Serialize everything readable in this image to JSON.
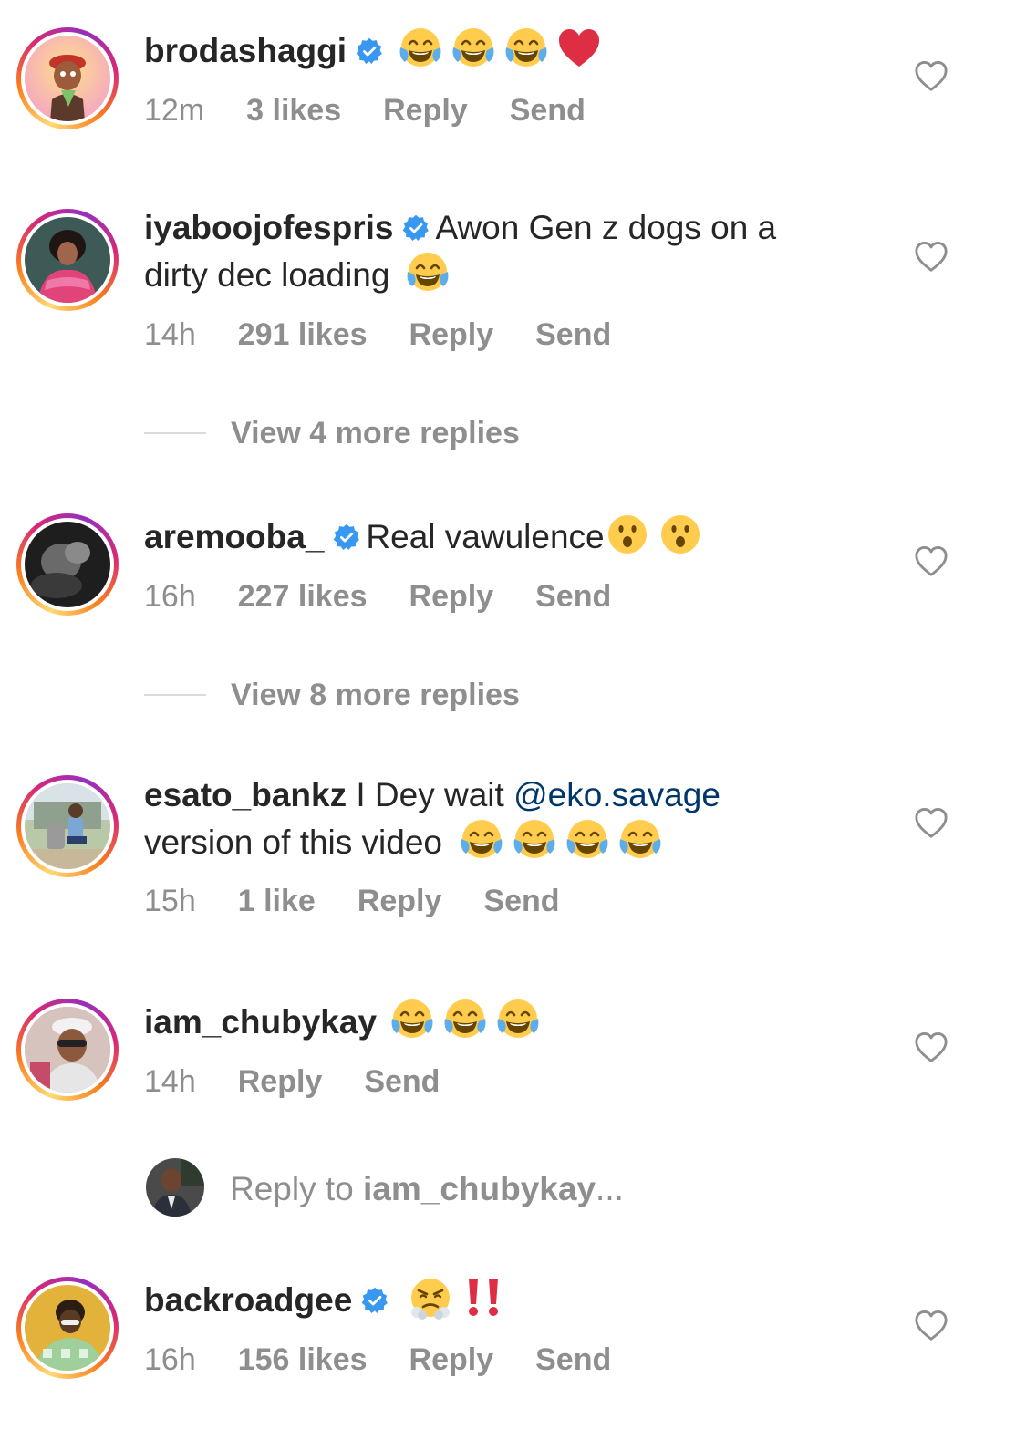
{
  "colors": {
    "text": "#262626",
    "meta": "#8e8e8e",
    "mention": "#00376b",
    "verified": "#3897f0"
  },
  "comments": [
    {
      "username": "brodashaggi",
      "verified": true,
      "text": "",
      "emojis": [
        "joy-emoji",
        "joy-emoji",
        "joy-emoji",
        "heart-emoji"
      ],
      "time": "12m",
      "likes": "3 likes",
      "reply": "Reply",
      "send": "Send"
    },
    {
      "username": "iyaboojofespris",
      "verified": true,
      "text_line1": "Awon Gen z dogs on a",
      "text_line2": "dirty dec loading",
      "emojis": [
        "joy-emoji"
      ],
      "time": "14h",
      "likes": "291 likes",
      "reply": "Reply",
      "send": "Send",
      "view_more": "View 4 more replies"
    },
    {
      "username": "aremooba_",
      "verified": true,
      "text": "Real vawulence",
      "emojis": [
        "hushed-emoji",
        "hushed-emoji"
      ],
      "time": "16h",
      "likes": "227 likes",
      "reply": "Reply",
      "send": "Send",
      "view_more": "View 8 more replies"
    },
    {
      "username": "esato_bankz",
      "verified": false,
      "text_prefix": "I Dey wait",
      "mention": "@eko.savage",
      "text_line2": "version of this video",
      "emojis": [
        "joy-emoji",
        "joy-emoji",
        "joy-emoji",
        "joy-emoji"
      ],
      "time": "15h",
      "likes": "1 like",
      "reply": "Reply",
      "send": "Send"
    },
    {
      "username": "iam_chubykay",
      "verified": false,
      "emojis": [
        "joy-emoji",
        "joy-emoji",
        "joy-emoji"
      ],
      "time": "14h",
      "reply": "Reply",
      "send": "Send"
    },
    {
      "username": "backroadgee",
      "verified": true,
      "emojis": [
        "steam-nose-emoji",
        "double-exclamation-emoji"
      ],
      "time": "16h",
      "likes": "156 likes",
      "reply": "Reply",
      "send": "Send"
    }
  ],
  "reply_box": {
    "prefix": "Reply to ",
    "username": "iam_chubykay",
    "suffix": "..."
  }
}
